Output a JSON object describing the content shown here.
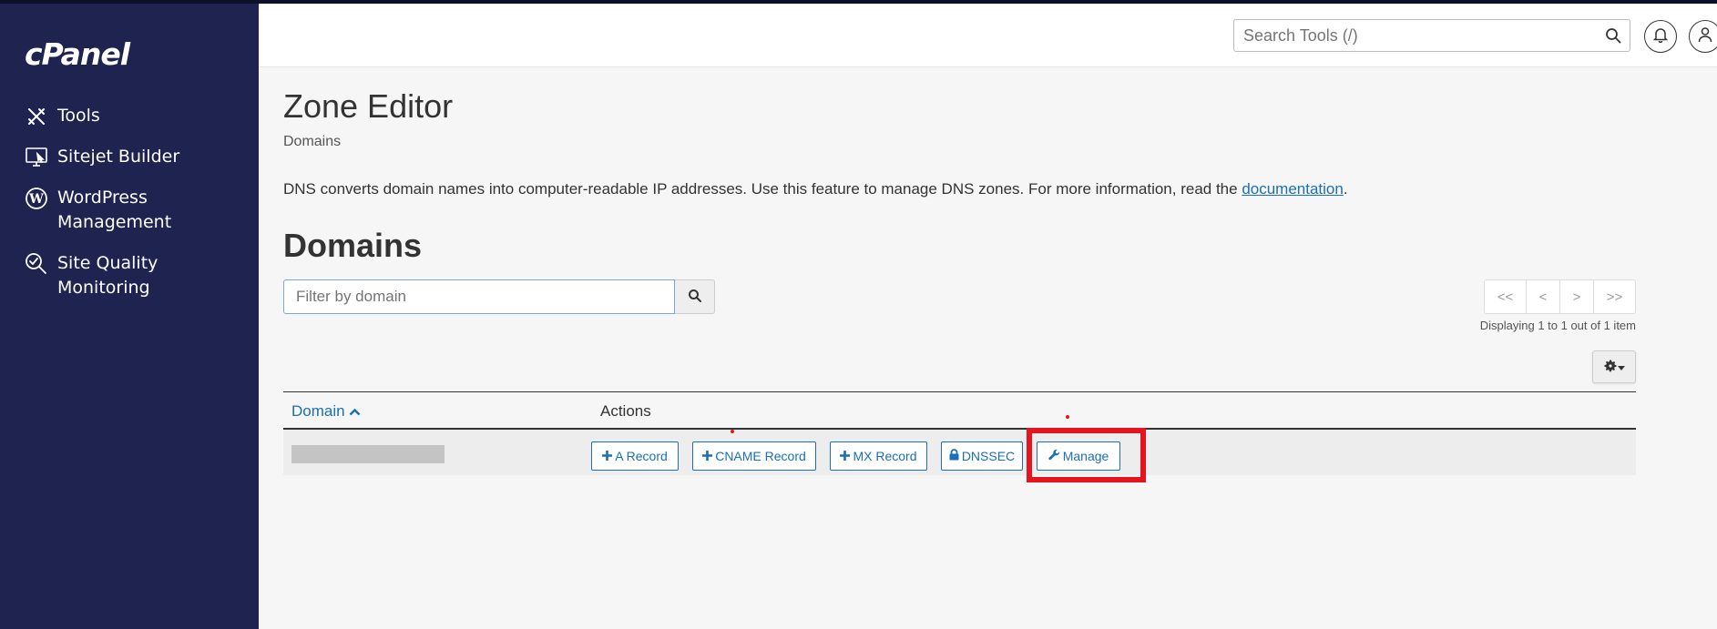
{
  "app": {
    "logo": "cPanel"
  },
  "sidebar": {
    "items": [
      {
        "label": "Tools",
        "icon": "tools-icon"
      },
      {
        "label": "Sitejet Builder",
        "icon": "monitor-icon"
      },
      {
        "label": "WordPress\nManagement",
        "icon": "wordpress-icon"
      },
      {
        "label": "Site Quality\nMonitoring",
        "icon": "site-quality-icon"
      }
    ]
  },
  "header": {
    "search_placeholder": "Search Tools (/)"
  },
  "page": {
    "title": "Zone Editor",
    "breadcrumb": "Domains",
    "description_prefix": "DNS converts domain names into computer-readable IP addresses. Use this feature to manage DNS zones. For more information, read the ",
    "description_link": "documentation",
    "description_suffix": ".",
    "section_title": "Domains",
    "filter_placeholder": "Filter by domain",
    "pager": {
      "first": "<<",
      "prev": "<",
      "next": ">",
      "last": ">>"
    },
    "displaying": "Displaying 1 to 1 out of 1 item"
  },
  "table": {
    "headers": {
      "domain": "Domain",
      "actions": "Actions"
    },
    "rows": [
      {
        "actions": {
          "a_record": "A Record",
          "cname_record": "CNAME Record",
          "mx_record": "MX Record",
          "dnssec": "DNSSEC",
          "manage": "Manage"
        }
      }
    ]
  },
  "colors": {
    "sidebar": "#1e2350",
    "link": "#1a6fb5",
    "highlight": "#e5151f"
  }
}
